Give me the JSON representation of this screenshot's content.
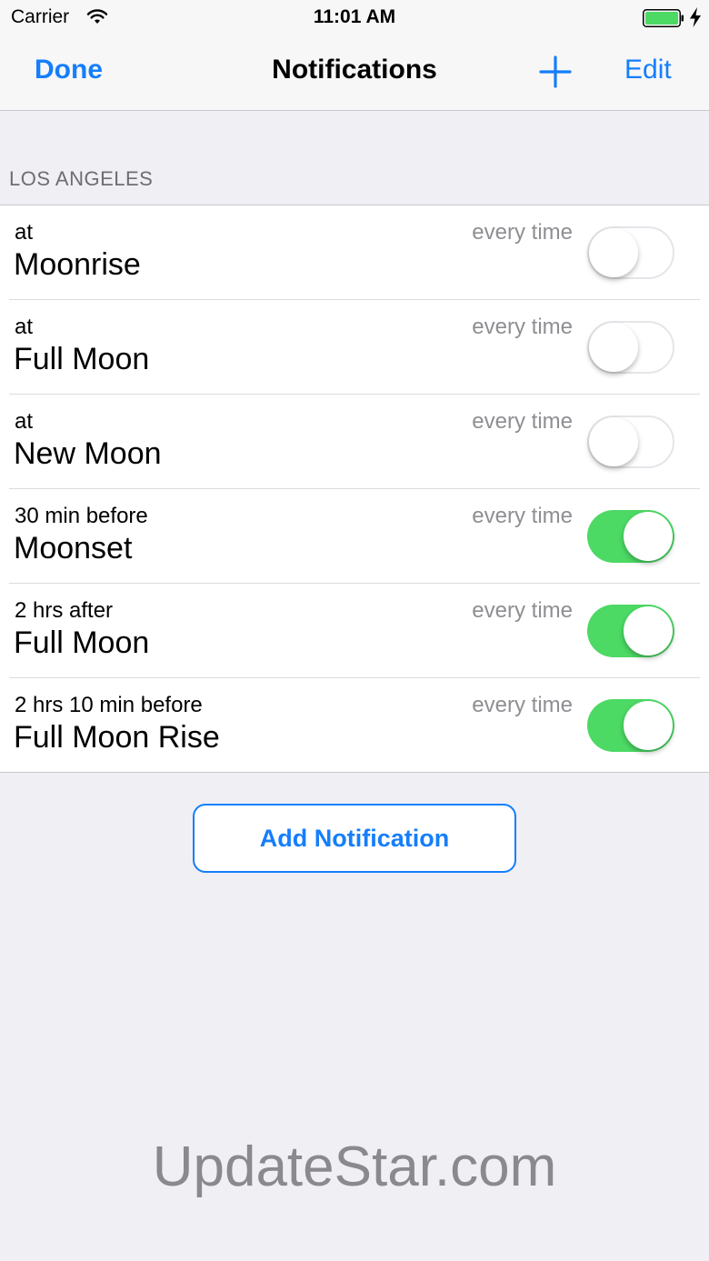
{
  "status_bar": {
    "carrier": "Carrier",
    "time": "11:01 AM"
  },
  "nav": {
    "done_label": "Done",
    "title": "Notifications",
    "add_icon": "plus-icon",
    "edit_label": "Edit"
  },
  "section": {
    "header": "LOS ANGELES"
  },
  "notifications": [
    {
      "timing": "at",
      "event": "Moonrise",
      "repeat": "every time",
      "enabled": false
    },
    {
      "timing": "at",
      "event": "Full Moon",
      "repeat": "every time",
      "enabled": false
    },
    {
      "timing": "at",
      "event": "New Moon",
      "repeat": "every time",
      "enabled": false
    },
    {
      "timing": "30 min before",
      "event": "Moonset",
      "repeat": "every time",
      "enabled": true
    },
    {
      "timing": "2 hrs after",
      "event": "Full Moon",
      "repeat": "every time",
      "enabled": true
    },
    {
      "timing": "2 hrs 10 min before",
      "event": "Full Moon Rise",
      "repeat": "every time",
      "enabled": true
    }
  ],
  "add_button_label": "Add Notification",
  "watermark": "UpdateStar.com",
  "colors": {
    "accent": "#157efb",
    "switch_on": "#4cd964",
    "battery": "#4cd964",
    "background": "#efeff4"
  }
}
